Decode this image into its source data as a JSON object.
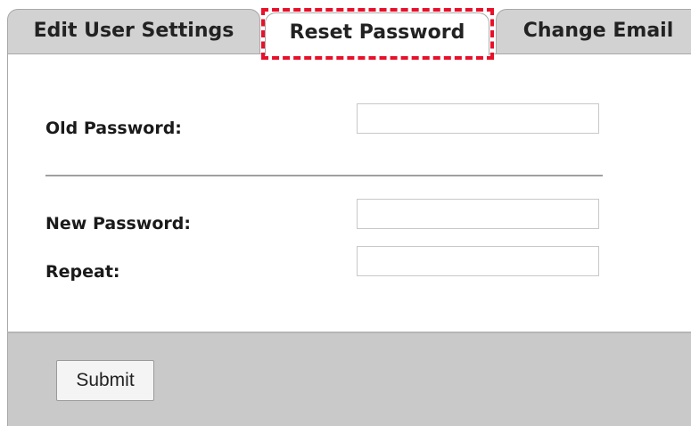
{
  "tabs": [
    {
      "label": "Edit User Settings",
      "active": false
    },
    {
      "label": "Reset Password",
      "active": true
    },
    {
      "label": "Change Email",
      "active": false
    }
  ],
  "highlight_color": "#e8102a",
  "form": {
    "old_password_label": "Old Password:",
    "old_password_value": "",
    "new_password_label": "New Password:",
    "new_password_value": "",
    "repeat_label": "Repeat:",
    "repeat_value": ""
  },
  "footer": {
    "submit_label": "Submit"
  }
}
